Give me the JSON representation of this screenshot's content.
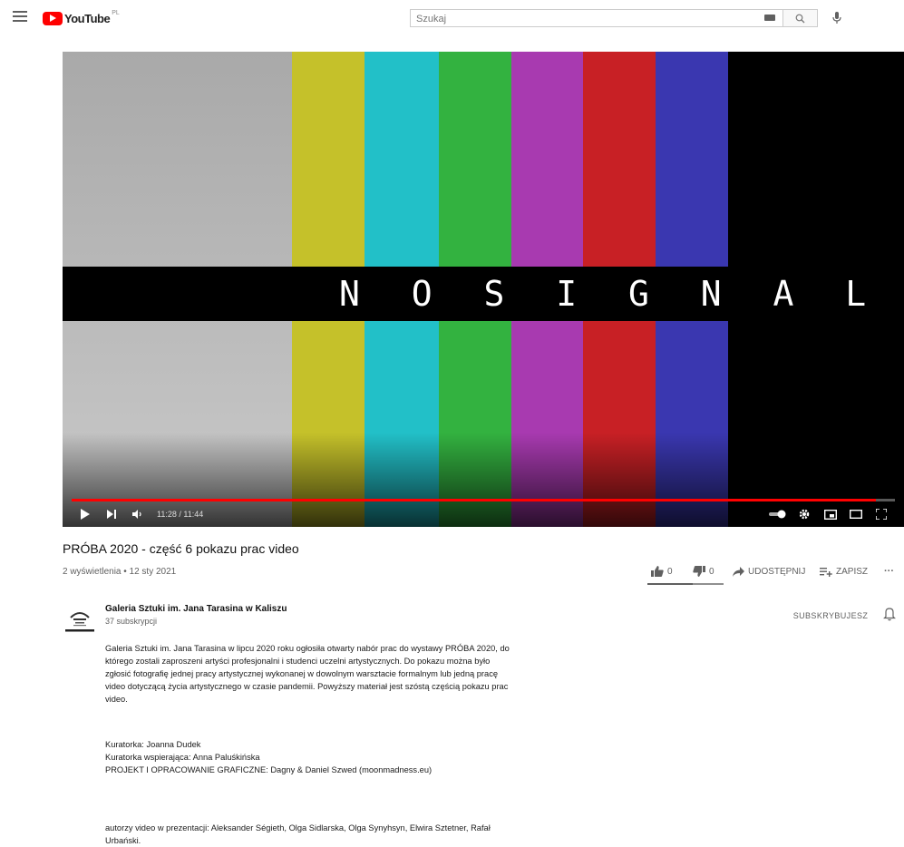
{
  "header": {
    "logo_text": "YouTube",
    "country_code": "PL",
    "search_placeholder": "Szukaj"
  },
  "player": {
    "overlay_text": "N O  S I G N A L",
    "current_time": "11:28",
    "duration": "11:44",
    "time_label": "11:28 / 11:44",
    "progress_fraction": 0.977,
    "bar_colors": [
      "#a9a9a9",
      "#c5c12a",
      "#22c0c8",
      "#33b240",
      "#a83ab0",
      "#c82025",
      "#3a37b0",
      "#000000"
    ]
  },
  "video": {
    "title": "PRÓBA 2020 - część 6 pokazu prac video",
    "meta": "2 wyświetlenia • 12 sty 2021",
    "likes": "0",
    "dislikes": "0",
    "share_label": "UDOSTĘPNIJ",
    "save_label": "ZAPISZ",
    "more_label": "···"
  },
  "channel": {
    "name": "Galeria Sztuki im. Jana Tarasina w Kaliszu",
    "subscribers": "37 subskrypcji",
    "subscribe_state_label": "SUBSKRYBUJESZ"
  },
  "description": {
    "paragraph1": "Galeria Sztuki im. Jana Tarasina w lipcu 2020 roku ogłosiła otwarty nabór prac do wystawy PRÓBA 2020, do którego zostali zaproszeni artyści profesjonalni i studenci uczelni artystycznych. Do pokazu można było zgłosić fotografię jednej pracy artystycznej wykonanej w dowolnym warsztacie formalnym lub jedną pracę video dotyczącą życia artystycznego w czasie pandemii. Powyższy materiał jest szóstą częścią pokazu prac video.",
    "line_curator": "Kuratorka: Joanna Dudek",
    "line_assist_curator": "Kuratorka wspierająca: Anna Paluśkińska",
    "line_project": "PROJEKT I OPRACOWANIE GRAFICZNE: Dagny & Daniel Szwed (moonmadness.eu)",
    "line_authors": "autorzy video w prezentacji: Aleksander Ségieth, Olga Sidlarska, Olga Synyhsyn, Elwira Sztetner, Rafał Urbański."
  }
}
